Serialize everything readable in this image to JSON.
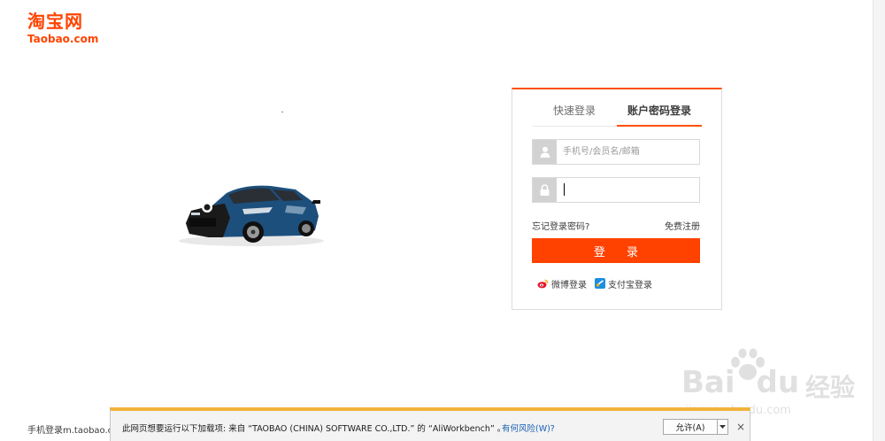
{
  "logo": {
    "chinese": "淘宝网",
    "english": "Taobao.com"
  },
  "login": {
    "tabs": [
      {
        "label": "快速登录",
        "active": false
      },
      {
        "label": "账户密码登录",
        "active": true
      }
    ],
    "username_placeholder": "手机号/会员名/邮箱",
    "password_value": "",
    "forgot_password": "忘记登录密码?",
    "register": "免费注册",
    "submit_label": "登 录",
    "alt_logins": [
      {
        "label": "微博登录",
        "icon": "weibo-icon"
      },
      {
        "label": "支付宝登录",
        "icon": "alipay-icon"
      }
    ]
  },
  "footer": {
    "mobile_login": "手机登录m.taobao.com"
  },
  "notification_bar": {
    "message": "此网页想要运行以下加载项: 来自 “TAOBAO (CHINA) SOFTWARE CO.,LTD.” 的 “AliWorkbench” 。",
    "risk_link": "有何风险(W)?",
    "allow_button": "允许(A)",
    "close": "×"
  },
  "watermark": {
    "brand": "Bai",
    "brand_end": "du",
    "sub": "经验",
    "url": "jingyan.baidu.com"
  },
  "colors": {
    "accent": "#ff4400",
    "button": "#ff4200",
    "notify_border": "#f0b33a",
    "link": "#1a5fb4"
  }
}
